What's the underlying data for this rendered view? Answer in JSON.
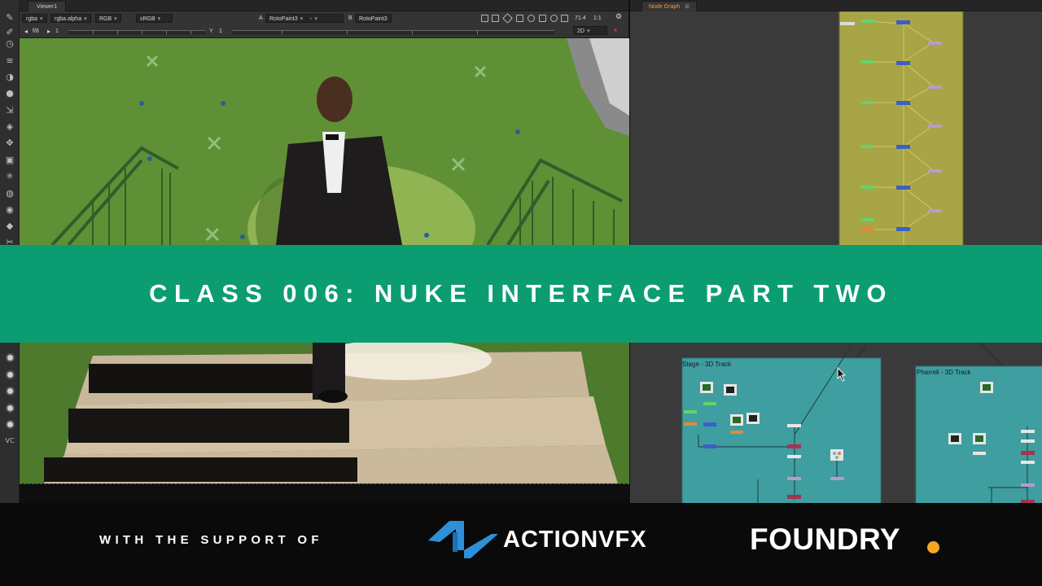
{
  "colors": {
    "banner_bg": "#0b9d71",
    "greenscreen": "#5c8c36",
    "node_graph_bg": "#3a3a3a",
    "backdrop_yellow": "#a7a545",
    "backdrop_teal": "#3e9ea0",
    "actionvfx_blue": "#2f8fd8",
    "foundry_accent": "#f5a623"
  },
  "viewer": {
    "tab_label": "Viewer1",
    "channels": "rgba",
    "channel_alpha": "rgba.alpha",
    "color_mode": "RGB",
    "lut": "sRGB",
    "input_a_letter": "A",
    "input_a": "RotoPaint3",
    "input_dash": "-",
    "input_b_letter": "B",
    "input_b": "RotoPaint3",
    "zoom": "71.4",
    "proxy": "1:1",
    "fstop": "f/8",
    "gain_value": "1",
    "gamma_label": "Y",
    "gamma_value": "1",
    "view_mode": "2D"
  },
  "node_graph": {
    "tab_label": "Node Graph",
    "backdrop_stage_label": "Stage - 3D Track",
    "backdrop_pharrell_label": "Pharrell - 3D Track"
  },
  "toolbar_icons": [
    "brush-icon",
    "paint-icon",
    "clock-icon",
    "channel-icon",
    "color-icon",
    "filter-icon",
    "keyer-icon",
    "merge-icon",
    "transform-icon",
    "3d-icon",
    "particles-icon",
    "deep-icon",
    "views-icon",
    "metadata-icon",
    "toolsets-icon",
    "other-icon",
    "gizmo-icon"
  ],
  "banner": {
    "title": "CLASS 006: NUKE INTERFACE PART TWO"
  },
  "footer": {
    "support_text": "WITH THE SUPPORT OF",
    "actionvfx_label": "ACTIONVFX",
    "foundry_label": "FOUNDRY"
  }
}
